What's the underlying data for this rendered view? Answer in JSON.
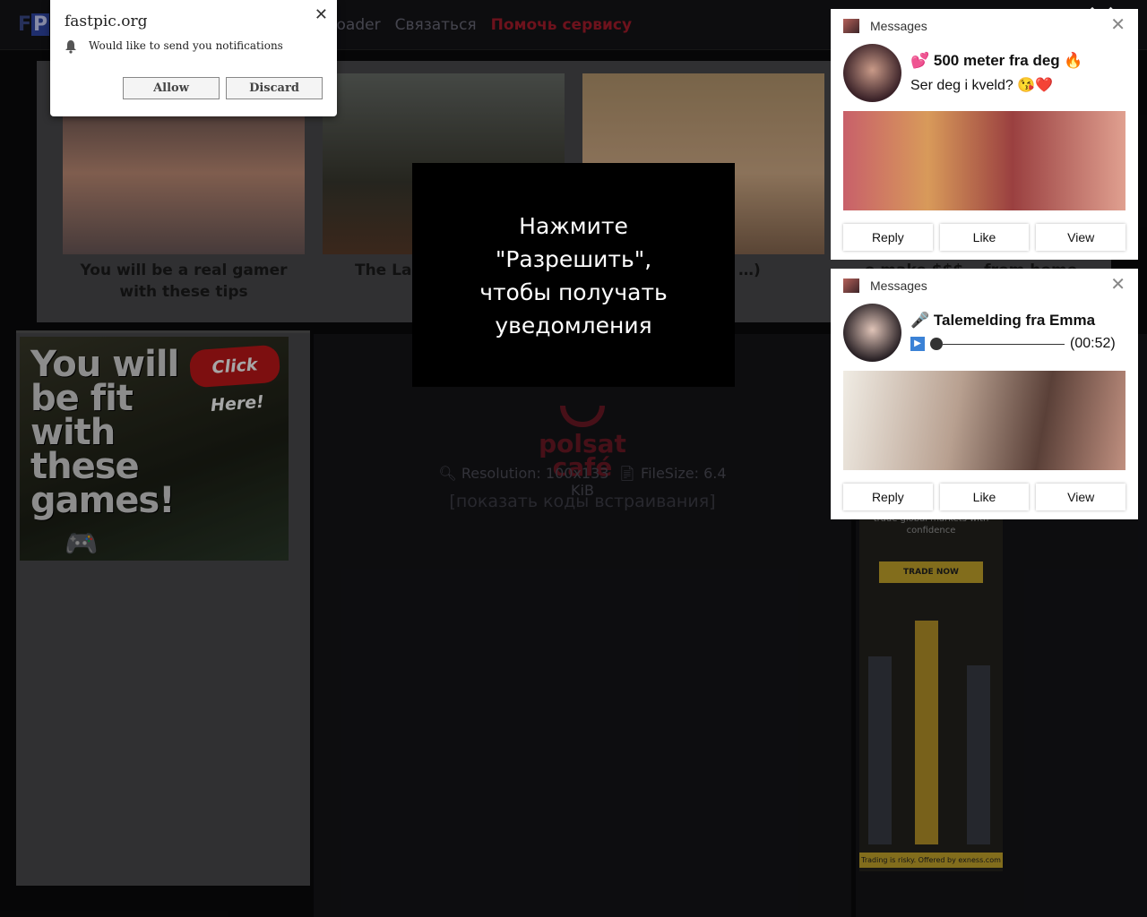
{
  "topbar": {
    "logo_text": "FP",
    "nav": [
      {
        "label": "ploader"
      },
      {
        "label": "Связаться"
      },
      {
        "label": "Помочь сервису"
      }
    ]
  },
  "ad_strip": {
    "tiles": [
      {
        "caption": "You will be a real gamer with these tips"
      },
      {
        "caption": "The La… Review: A…"
      },
      {
        "caption": "…els (free …)"
      },
      {
        "caption": "…o make $$$ …from home"
      }
    ]
  },
  "left_ad": {
    "headline": "You will be fit with these games!",
    "cta": "Click Here!"
  },
  "main": {
    "logo_text": "polsat café",
    "resolution_label": "Resolution: 100x133",
    "filesize_label": "FileSize: 6.4 KiB",
    "embed_codes_link": "[показать коды встраивания]"
  },
  "right_ad": {
    "tagline": "trade global markets with confidence",
    "cta": "TRADE NOW",
    "footer": "Trading is risky. Offered by exness.com"
  },
  "prompt_overlay": {
    "text": "Нажмите \"Разрешить\", чтобы получать уведомления"
  },
  "browser_prompt": {
    "site": "fastpic.org",
    "message": "Would like to send you notifications",
    "allow_label": "Allow",
    "discard_label": "Discard"
  },
  "notifications": [
    {
      "app": "Messages",
      "title": "💕 500 meter fra deg 🔥",
      "subtitle": "Ser deg i kveld? 😘❤️",
      "reply": "Reply",
      "like": "Like",
      "view": "View"
    },
    {
      "app": "Messages",
      "title": "🎤 Talemelding fra Emma",
      "duration": "(00:52)",
      "reply": "Reply",
      "like": "Like",
      "view": "View"
    }
  ],
  "colors": {
    "help_link": "#a81c2c",
    "polsat": "#6e1a26",
    "exness_yellow": "#c8a82c"
  }
}
